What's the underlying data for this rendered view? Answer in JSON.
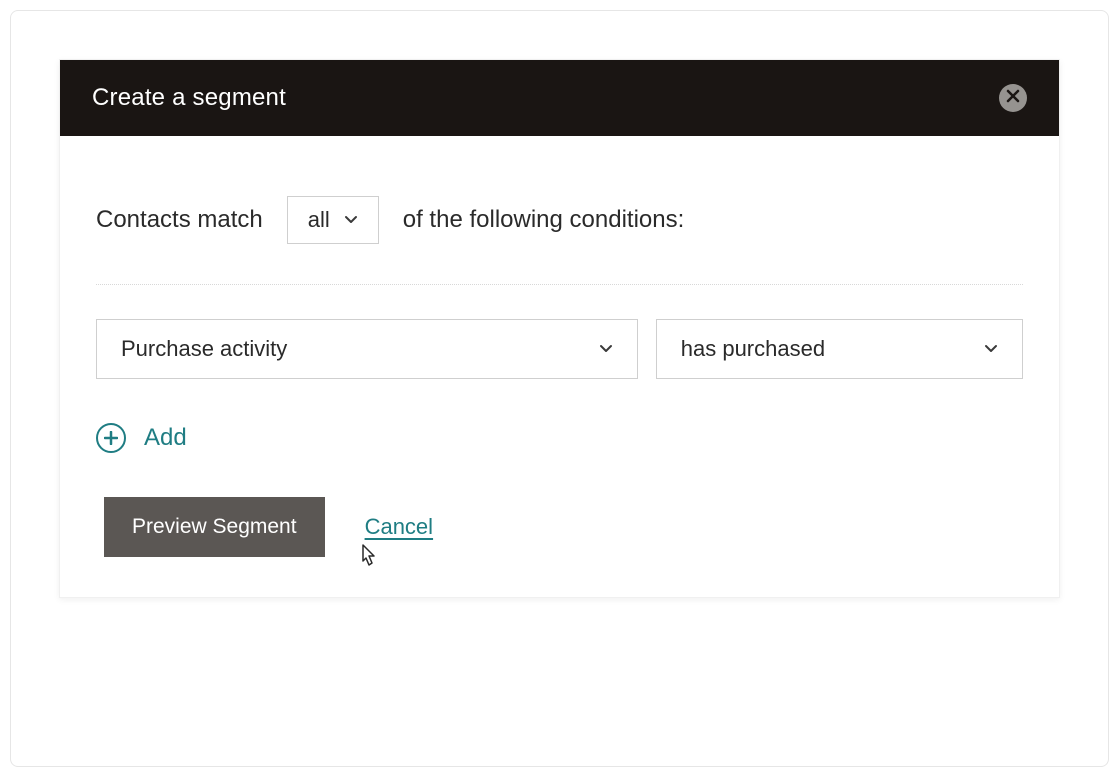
{
  "modal": {
    "title": "Create a segment",
    "match_prefix": "Contacts match",
    "match_selector": "all",
    "match_suffix": "of the following conditions:",
    "condition": {
      "field": "Purchase activity",
      "operator": "has purchased"
    },
    "add_label": "Add",
    "preview_label": "Preview Segment",
    "cancel_label": "Cancel"
  }
}
